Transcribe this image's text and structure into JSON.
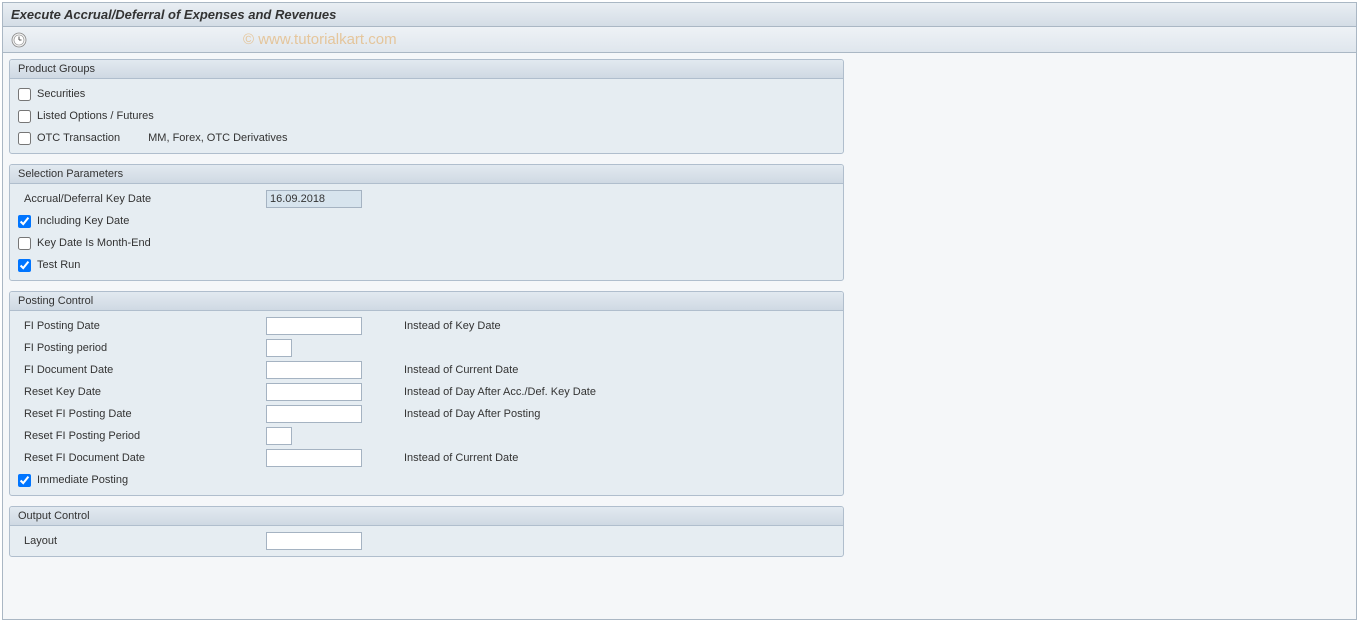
{
  "title": "Execute Accrual/Deferral of Expenses and Revenues",
  "watermark": "© www.tutorialkart.com",
  "productGroups": {
    "header": "Product Groups",
    "securities": {
      "label": "Securities",
      "checked": false
    },
    "listedOptions": {
      "label": "Listed Options / Futures",
      "checked": false
    },
    "otc": {
      "label": "OTC Transaction",
      "extra": "MM, Forex, OTC Derivatives",
      "checked": false
    }
  },
  "selectionParams": {
    "header": "Selection Parameters",
    "keyDate": {
      "label": "Accrual/Deferral Key Date",
      "value": "16.09.2018"
    },
    "includingKeyDate": {
      "label": "Including Key Date",
      "checked": true
    },
    "monthEnd": {
      "label": "Key Date Is Month-End",
      "checked": false
    },
    "testRun": {
      "label": "Test Run",
      "checked": true
    }
  },
  "postingControl": {
    "header": "Posting Control",
    "fiPostingDate": {
      "label": "FI Posting Date",
      "value": "",
      "hint": "Instead of Key Date"
    },
    "fiPostingPeriod": {
      "label": "FI Posting period",
      "value": ""
    },
    "fiDocumentDate": {
      "label": "FI Document Date",
      "value": "",
      "hint": "Instead of Current Date"
    },
    "resetKeyDate": {
      "label": "Reset Key Date",
      "value": "",
      "hint": "Instead of Day After Acc./Def. Key Date"
    },
    "resetFiPostingDate": {
      "label": "Reset FI Posting Date",
      "value": "",
      "hint": "Instead of Day After Posting"
    },
    "resetFiPostingPeriod": {
      "label": "Reset FI Posting Period",
      "value": ""
    },
    "resetFiDocumentDate": {
      "label": "Reset FI Document Date",
      "value": "",
      "hint": "Instead of Current Date"
    },
    "immediatePosting": {
      "label": "Immediate Posting",
      "checked": true
    }
  },
  "outputControl": {
    "header": "Output Control",
    "layout": {
      "label": "Layout",
      "value": ""
    }
  }
}
